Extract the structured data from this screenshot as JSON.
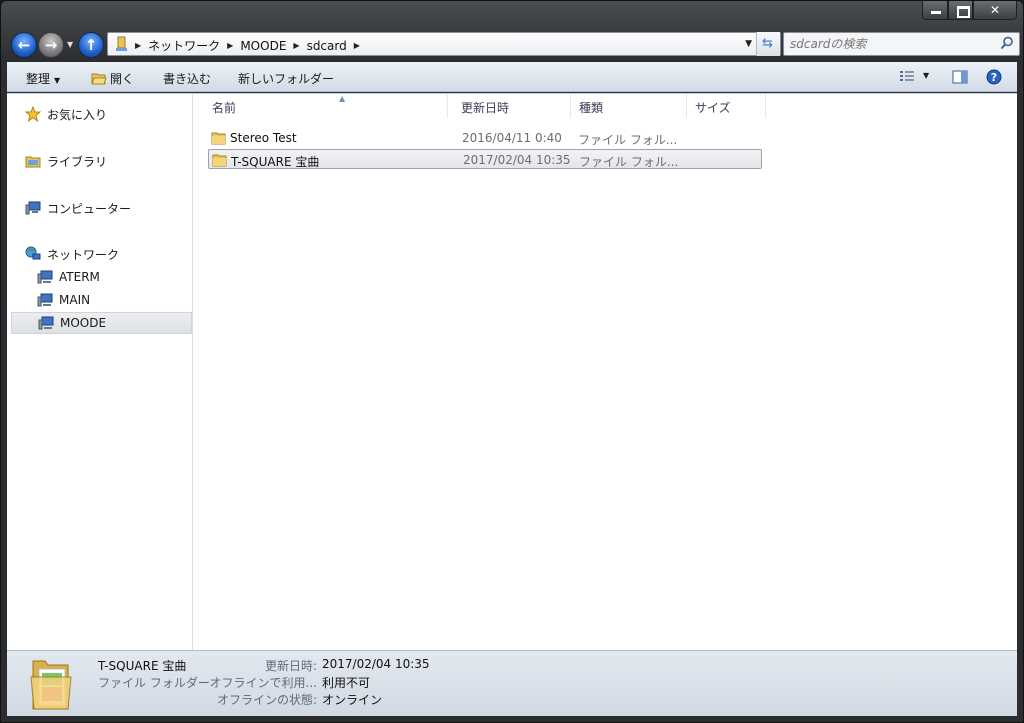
{
  "address": {
    "crumbs": [
      "ネットワーク",
      "MOODE",
      "sdcard"
    ]
  },
  "search": {
    "placeholder": "sdcardの検索"
  },
  "toolbar": {
    "organize": "整理",
    "open": "開く",
    "burn": "書き込む",
    "new_folder": "新しいフォルダー"
  },
  "nav": {
    "favorites": "お気に入り",
    "libraries": "ライブラリ",
    "computer": "コンピューター",
    "network": "ネットワーク",
    "network_items": [
      "ATERM",
      "MAIN",
      "MOODE"
    ],
    "selected": "MOODE"
  },
  "columns": [
    "名前",
    "更新日時",
    "種類",
    "サイズ"
  ],
  "files": [
    {
      "name": "Stereo Test",
      "date": "2016/04/11 0:40",
      "type": "ファイル フォル...",
      "size": ""
    },
    {
      "name": "T-SQUARE 宝曲",
      "date": "2017/02/04 10:35",
      "type": "ファイル フォル...",
      "size": "",
      "selected": true
    }
  ],
  "details": {
    "name": "T-SQUARE 宝曲",
    "type": "ファイル フォルダー",
    "modified_label": "更新日時:",
    "modified_value": "2017/02/04 10:35",
    "offline_avail_label": "オフラインで利用...",
    "offline_avail_value": "利用不可",
    "offline_status_label": "オフラインの状態:",
    "offline_status_value": "オンライン"
  },
  "colors": {
    "accent": "#1f5fc8",
    "selection_border": "#9da3ab",
    "folder": "#e8c45a"
  }
}
